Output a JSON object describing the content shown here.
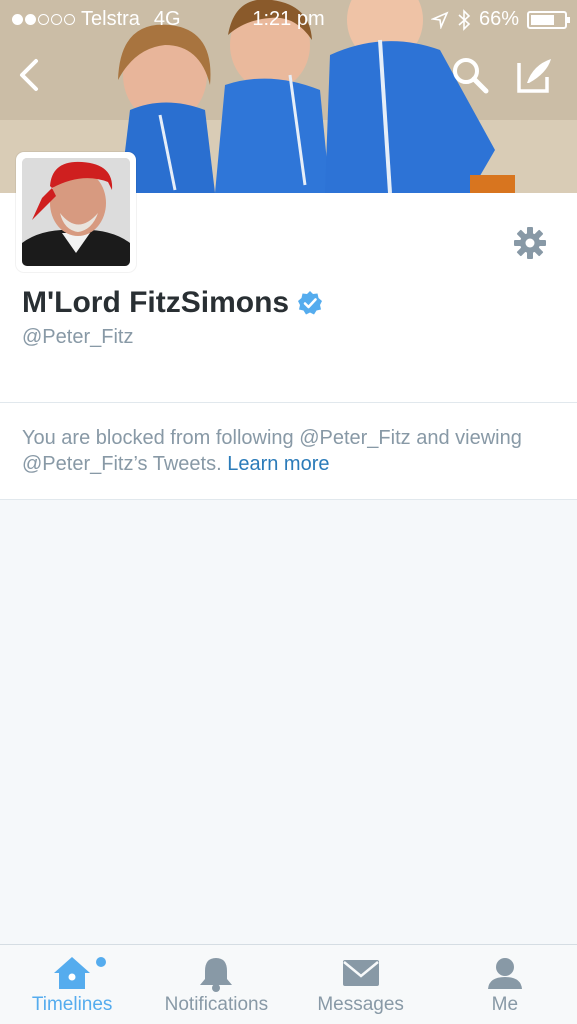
{
  "status_bar": {
    "carrier": "Telstra",
    "network": "4G",
    "time": "1:21 pm",
    "battery": "66%",
    "signal_bars_filled": 2,
    "signal_bars_total": 5
  },
  "header": {
    "back_icon": "chevron-left-icon",
    "search_icon": "search-icon",
    "compose_icon": "compose-tweet-icon"
  },
  "profile": {
    "name": "M'Lord FitzSimons",
    "handle": "@Peter_Fitz",
    "verified": true,
    "settings_icon": "gear-icon"
  },
  "blocked_notice": {
    "text": "You are blocked from following @Peter_Fitz and viewing @Peter_Fitz’s Tweets.",
    "link": "Learn more"
  },
  "tabs": [
    {
      "label": "Timelines",
      "icon": "home-icon",
      "active": true,
      "badge": true
    },
    {
      "label": "Notifications",
      "icon": "bell-icon",
      "active": false
    },
    {
      "label": "Messages",
      "icon": "envelope-icon",
      "active": false
    },
    {
      "label": "Me",
      "icon": "person-icon",
      "active": false
    }
  ],
  "colors": {
    "accent": "#55acee",
    "link": "#2b7bb9",
    "muted": "#8899a6",
    "name": "#292f33"
  }
}
